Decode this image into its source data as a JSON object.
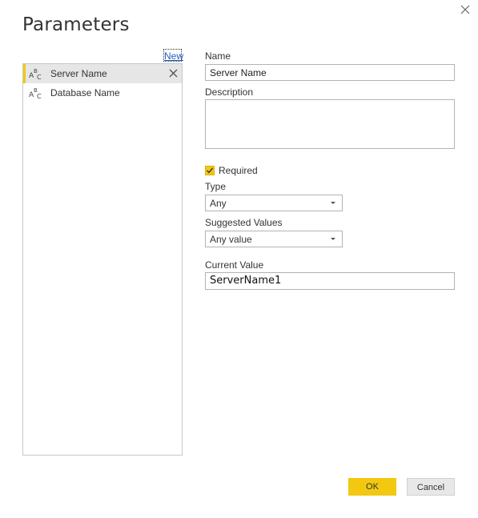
{
  "dialog": {
    "title": "Parameters",
    "close_icon": "close-icon"
  },
  "sidebar": {
    "new_label": "New",
    "items": [
      {
        "label": "Server Name",
        "icon": "text-type-icon",
        "selected": true
      },
      {
        "label": "Database Name",
        "icon": "text-type-icon",
        "selected": false
      }
    ]
  },
  "form": {
    "name_label": "Name",
    "name_value": "Server Name",
    "description_label": "Description",
    "description_value": "",
    "required_label": "Required",
    "required_checked": true,
    "type_label": "Type",
    "type_value": "Any",
    "suggested_label": "Suggested Values",
    "suggested_value": "Any value",
    "current_label": "Current Value",
    "current_value": "ServerName1"
  },
  "buttons": {
    "ok_label": "OK",
    "cancel_label": "Cancel"
  },
  "colors": {
    "accent": "#f2c811",
    "link": "#1f5fbf"
  }
}
